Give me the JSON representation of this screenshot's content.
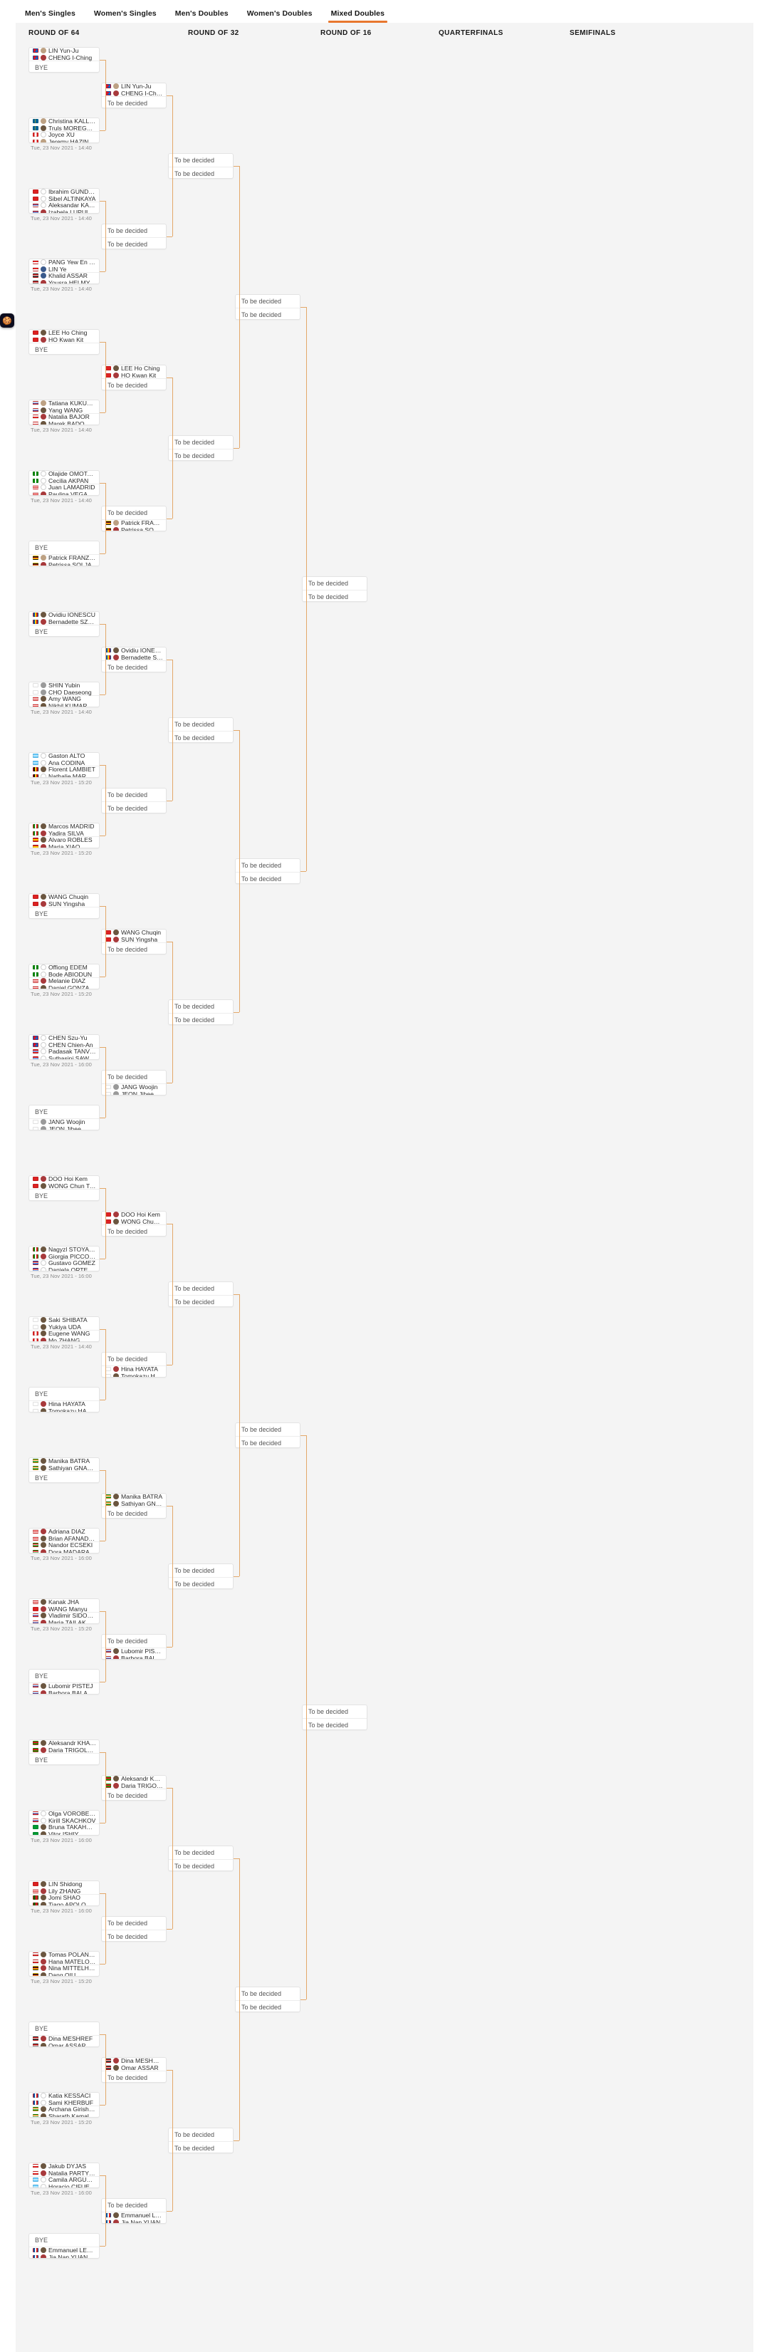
{
  "tabs": [
    {
      "label": "Men's Singles",
      "active": false
    },
    {
      "label": "Women's Singles",
      "active": false
    },
    {
      "label": "Men's Doubles",
      "active": false
    },
    {
      "label": "Women's Doubles",
      "active": false
    },
    {
      "label": "Mixed Doubles",
      "active": true
    }
  ],
  "rounds": [
    {
      "label": "ROUND OF 64"
    },
    {
      "label": "ROUND OF 32"
    },
    {
      "label": "ROUND OF 16"
    },
    {
      "label": "QUARTERFINALS"
    },
    {
      "label": "SEMIFINALS"
    }
  ],
  "cookie": {
    "icon": "cookie-icon",
    "glyph": "🍪"
  },
  "labels": {
    "bye": "BYE",
    "tbd": "To be decided"
  },
  "r64": [
    {
      "date": "",
      "a": [
        {
          "n": "LIN Yun-Ju",
          "f": "tpe",
          "av": "f-tan"
        },
        {
          "n": "CHENG I-Ching",
          "f": "tpe",
          "av": "f-red"
        }
      ],
      "b": "BYE"
    },
    {
      "date": "Tue, 23 Nov 2021 - 14:40",
      "a": [
        {
          "n": "Christina KALLBERG",
          "f": "swe",
          "av": "f-tan"
        },
        {
          "n": "Truls MOREGARD",
          "f": "swe",
          "av": "f-dark"
        }
      ],
      "b": [
        {
          "n": "Joyce XU",
          "f": "can",
          "av": "f-empty"
        },
        {
          "n": "Jeremy HAZIN",
          "f": "can",
          "av": "f-tan"
        }
      ]
    },
    {
      "date": "Tue, 23 Nov 2021 - 14:40",
      "a": [
        {
          "n": "Ibrahim GUNDUZ",
          "f": "tur",
          "av": "f-empty"
        },
        {
          "n": "Sibel ALTINKAYA",
          "f": "tur",
          "av": "f-empty"
        }
      ],
      "b": [
        {
          "n": "Aleksandar KARAKASEVIC",
          "f": "srb",
          "av": "f-empty"
        },
        {
          "n": "Izabela LUPULESKU",
          "f": "srb",
          "av": "f-red"
        }
      ]
    },
    {
      "date": "Tue, 23 Nov 2021 - 14:40",
      "a": [
        {
          "n": "PANG Yew En Koen",
          "f": "sgp",
          "av": "f-empty"
        },
        {
          "n": "LIN Ye",
          "f": "sgp",
          "av": "f-blue"
        }
      ],
      "b": [
        {
          "n": "Khalid ASSAR",
          "f": "egy",
          "av": "f-blue"
        },
        {
          "n": "Yousra HELMY",
          "f": "egy",
          "av": "f-red"
        }
      ]
    },
    {
      "date": "",
      "a": [
        {
          "n": "LEE Ho Ching",
          "f": "hkg",
          "av": "f-dark"
        },
        {
          "n": "HO Kwan Kit",
          "f": "hkg",
          "av": "f-red"
        }
      ],
      "b": "BYE"
    },
    {
      "date": "Tue, 23 Nov 2021 - 14:40",
      "a": [
        {
          "n": "Tatiana KUKULKOVA",
          "f": "svk",
          "av": "f-tan"
        },
        {
          "n": "Yang WANG",
          "f": "svk",
          "av": "f-dark"
        }
      ],
      "b": [
        {
          "n": "Natalia BAJOR",
          "f": "pol",
          "av": "f-red"
        },
        {
          "n": "Marek BADOWSKI",
          "f": "pol",
          "av": "f-dark"
        }
      ]
    },
    {
      "date": "Tue, 23 Nov 2021 - 14:40",
      "a": [
        {
          "n": "Olajide OMOTAYO",
          "f": "ngr",
          "av": "f-empty"
        },
        {
          "n": "Cecilia AKPAN",
          "f": "ngr",
          "av": "f-empty"
        }
      ],
      "b": [
        {
          "n": "Juan LAMADRID",
          "f": "pur",
          "av": "f-empty"
        },
        {
          "n": "Paulina VEGA",
          "f": "pur",
          "av": "f-red"
        }
      ]
    },
    {
      "date": "",
      "a": "BYE",
      "b": [
        {
          "n": "Patrick FRANZISKA",
          "f": "ger",
          "av": "f-tan"
        },
        {
          "n": "Petrissa SOLJA",
          "f": "ger",
          "av": "f-red"
        }
      ]
    },
    {
      "date": "",
      "a": [
        {
          "n": "Ovidiu IONESCU",
          "f": "rou",
          "av": "f-dark"
        },
        {
          "n": "Bernadette SZOCS",
          "f": "rou",
          "av": "f-red"
        }
      ],
      "b": "BYE"
    },
    {
      "date": "Tue, 23 Nov 2021 - 14:40",
      "a": [
        {
          "n": "SHIN Yubin",
          "f": "kor",
          "av": "f-grey"
        },
        {
          "n": "CHO Daeseong",
          "f": "kor",
          "av": "f-grey"
        }
      ],
      "b": [
        {
          "n": "Amy WANG",
          "f": "usa",
          "av": "f-dark"
        },
        {
          "n": "Nikhil KUMAR",
          "f": "usa",
          "av": "f-dark"
        }
      ]
    },
    {
      "date": "Tue, 23 Nov 2021 - 15:20",
      "a": [
        {
          "n": "Gaston ALTO",
          "f": "arg",
          "av": "f-empty"
        },
        {
          "n": "Ana CODINA",
          "f": "arg",
          "av": "f-empty"
        }
      ],
      "b": [
        {
          "n": "Florent LAMBIET",
          "f": "bel",
          "av": "f-dark"
        },
        {
          "n": "Nathalie MARCHETTI",
          "f": "bel",
          "av": "f-empty"
        }
      ]
    },
    {
      "date": "Tue, 23 Nov 2021 - 15:20",
      "a": [
        {
          "n": "Marcos MADRID",
          "f": "mex",
          "av": "f-dark"
        },
        {
          "n": "Yadira SILVA",
          "f": "mex",
          "av": "f-red"
        }
      ],
      "b": [
        {
          "n": "Alvaro ROBLES",
          "f": "esp",
          "av": "f-dark"
        },
        {
          "n": "Maria XIAO",
          "f": "esp",
          "av": "f-red"
        }
      ]
    },
    {
      "date": "",
      "a": [
        {
          "n": "WANG Chuqin",
          "f": "chn",
          "av": "f-dark"
        },
        {
          "n": "SUN Yingsha",
          "f": "chn",
          "av": "f-red"
        }
      ],
      "b": "BYE"
    },
    {
      "date": "Tue, 23 Nov 2021 - 15:20",
      "a": [
        {
          "n": "Offiong EDEM",
          "f": "ngr",
          "av": "f-empty"
        },
        {
          "n": "Bode ABIODUN",
          "f": "ngr",
          "av": "f-empty"
        }
      ],
      "b": [
        {
          "n": "Melanie DIAZ",
          "f": "pur",
          "av": "f-red"
        },
        {
          "n": "Daniel GONZALEZ",
          "f": "pur",
          "av": "f-dark"
        }
      ]
    },
    {
      "date": "Tue, 23 Nov 2021 - 16:00",
      "a": [
        {
          "n": "CHEN Szu-Yu",
          "f": "tpe",
          "av": "f-empty"
        },
        {
          "n": "CHEN Chien-An",
          "f": "tpe",
          "av": "f-empty"
        }
      ],
      "b": [
        {
          "n": "Padasak TANVIRIYAVECHAKUL",
          "f": "tha",
          "av": "f-empty"
        },
        {
          "n": "Suthasini SAWETTABUT",
          "f": "tha",
          "av": "f-empty"
        }
      ]
    },
    {
      "date": "",
      "a": "BYE",
      "b": [
        {
          "n": "JANG Woojin",
          "f": "kor",
          "av": "f-grey"
        },
        {
          "n": "JEON Jihee",
          "f": "kor",
          "av": "f-grey"
        }
      ]
    },
    {
      "date": "",
      "a": [
        {
          "n": "DOO Hoi Kem",
          "f": "hkg",
          "av": "f-red"
        },
        {
          "n": "WONG Chun Ting",
          "f": "hkg",
          "av": "f-dark"
        }
      ],
      "b": "BYE"
    },
    {
      "date": "Tue, 23 Nov 2021 - 16:00",
      "a": [
        {
          "n": "Nagyzl STOYANOV",
          "f": "ita",
          "av": "f-dark"
        },
        {
          "n": "Giorgia PICCOLIN",
          "f": "ita",
          "av": "f-red"
        }
      ],
      "b": [
        {
          "n": "Gustavo GOMEZ",
          "f": "par",
          "av": "f-empty"
        },
        {
          "n": "Daniela ORTEGA",
          "f": "par",
          "av": "f-empty"
        }
      ]
    },
    {
      "date": "Tue, 23 Nov 2021 - 14:40",
      "a": [
        {
          "n": "Saki SHIBATA",
          "f": "jpn",
          "av": "f-dark"
        },
        {
          "n": "Yukiya UDA",
          "f": "jpn",
          "av": "f-dark"
        }
      ],
      "b": [
        {
          "n": "Eugene WANG",
          "f": "can",
          "av": "f-dark"
        },
        {
          "n": "Mo ZHANG",
          "f": "can",
          "av": "f-red"
        }
      ]
    },
    {
      "date": "",
      "a": "BYE",
      "b": [
        {
          "n": "Hina HAYATA",
          "f": "jpn",
          "av": "f-red"
        },
        {
          "n": "Tomokazu HARIMOTO",
          "f": "jpn",
          "av": "f-dark"
        }
      ]
    },
    {
      "date": "",
      "a": [
        {
          "n": "Manika BATRA",
          "f": "ind",
          "av": "f-dark"
        },
        {
          "n": "Sathiyan GNANASEKARAN",
          "f": "ind",
          "av": "f-dark"
        }
      ],
      "b": "BYE"
    },
    {
      "date": "Tue, 23 Nov 2021 - 16:00",
      "a": [
        {
          "n": "Adriana DIAZ",
          "f": "pur",
          "av": "f-red"
        },
        {
          "n": "Brian AFANADOR",
          "f": "pur",
          "av": "f-dark"
        }
      ],
      "b": [
        {
          "n": "Nandor ECSEKI",
          "f": "hun",
          "av": "f-dark"
        },
        {
          "n": "Dora MADARASZ",
          "f": "hun",
          "av": "f-red"
        }
      ]
    },
    {
      "date": "Tue, 23 Nov 2021 - 15:20",
      "a": [
        {
          "n": "Kanak JHA",
          "f": "usa",
          "av": "f-dark"
        },
        {
          "n": "WANG Manyu",
          "f": "chn",
          "av": "f-red"
        }
      ],
      "b": [
        {
          "n": "Vladimir SIDORENKO",
          "f": "rus",
          "av": "f-dark"
        },
        {
          "n": "Maria TAILAKOVA",
          "f": "rus",
          "av": "f-red"
        }
      ]
    },
    {
      "date": "",
      "a": "BYE",
      "b": [
        {
          "n": "Lubomir PISTEJ",
          "f": "svk",
          "av": "f-dark"
        },
        {
          "n": "Barbora BALAZOVA",
          "f": "svk",
          "av": "f-red"
        }
      ]
    },
    {
      "date": "",
      "a": [
        {
          "n": "Aleksandr KHANIN",
          "f": "blr",
          "av": "f-dark"
        },
        {
          "n": "Daria TRIGOLOS",
          "f": "blr",
          "av": "f-red"
        }
      ],
      "b": "BYE"
    },
    {
      "date": "Tue, 23 Nov 2021 - 16:00",
      "a": [
        {
          "n": "Olga VOROBEVA",
          "f": "rus",
          "av": "f-empty"
        },
        {
          "n": "Kirill SKACHKOV",
          "f": "rus",
          "av": "f-empty"
        }
      ],
      "b": [
        {
          "n": "Bruna TAKAHASHI",
          "f": "bra",
          "av": "f-dark"
        },
        {
          "n": "Vitor ISHIY",
          "f": "bra",
          "av": "f-dark"
        }
      ]
    },
    {
      "date": "Tue, 23 Nov 2021 - 16:00",
      "a": [
        {
          "n": "LIN Shidong",
          "f": "chn",
          "av": "f-dark"
        },
        {
          "n": "Lily ZHANG",
          "f": "usa",
          "av": "f-red"
        }
      ],
      "b": [
        {
          "n": "Jomi SHAO",
          "f": "por",
          "av": "f-dark"
        },
        {
          "n": "Tiago APOLONIA",
          "f": "por",
          "av": "f-dark"
        }
      ]
    },
    {
      "date": "Tue, 23 Nov 2021 - 15:20",
      "a": [
        {
          "n": "Tomas POLANSKY",
          "f": "cze",
          "av": "f-dark"
        },
        {
          "n": "Hana MATELOVA",
          "f": "cze",
          "av": "f-red"
        }
      ],
      "b": [
        {
          "n": "Nina MITTELHAM",
          "f": "ger",
          "av": "f-red"
        },
        {
          "n": "Dang QIU",
          "f": "ger",
          "av": "f-dark"
        }
      ]
    },
    {
      "date": "",
      "a": "BYE",
      "b": [
        {
          "n": "Dina MESHREF",
          "f": "egy",
          "av": "f-red"
        },
        {
          "n": "Omar ASSAR",
          "f": "egy",
          "av": "f-dark"
        }
      ]
    },
    {
      "date": "Tue, 23 Nov 2021 - 15:20",
      "a": [
        {
          "n": "Katia KESSACI",
          "f": "fra",
          "av": "f-empty"
        },
        {
          "n": "Sami KHERBUF",
          "f": "fra",
          "av": "f-empty"
        }
      ],
      "b": [
        {
          "n": "Archana Girish KAMATH",
          "f": "ind",
          "av": "f-dark"
        },
        {
          "n": "Sharath Kamal ACHANTA",
          "f": "ind",
          "av": "f-dark"
        }
      ]
    },
    {
      "date": "Tue, 23 Nov 2021 - 16:00",
      "a": [
        {
          "n": "Jakub DYJAS",
          "f": "pol",
          "av": "f-dark"
        },
        {
          "n": "Natalia PARTYKA",
          "f": "pol",
          "av": "f-red"
        }
      ],
      "b": [
        {
          "n": "Camila ARGUELLES",
          "f": "arg",
          "av": "f-empty"
        },
        {
          "n": "Horacio CIFUENTES",
          "f": "arg",
          "av": "f-empty"
        }
      ]
    },
    {
      "date": "",
      "a": "BYE",
      "b": [
        {
          "n": "Emmanuel LEBESSON",
          "f": "fra",
          "av": "f-dark"
        },
        {
          "n": "Jia Nan YUAN",
          "f": "fra",
          "av": "f-red"
        }
      ]
    }
  ],
  "r32": [
    {
      "a": [
        {
          "n": "LIN Yun-Ju",
          "f": "tpe",
          "av": "f-tan"
        },
        {
          "n": "CHENG I-Ching",
          "f": "tpe",
          "av": "f-red"
        }
      ],
      "b": "TBD"
    },
    {
      "a": "TBD",
      "b": "TBD"
    },
    {
      "a": [
        {
          "n": "LEE Ho Ching",
          "f": "hkg",
          "av": "f-dark"
        },
        {
          "n": "HO Kwan Kit",
          "f": "hkg",
          "av": "f-red"
        }
      ],
      "b": "TBD"
    },
    {
      "a": "TBD",
      "b": [
        {
          "n": "Patrick FRANZISKA",
          "f": "ger",
          "av": "f-tan"
        },
        {
          "n": "Petrissa SOLJA",
          "f": "ger",
          "av": "f-red"
        }
      ]
    },
    {
      "a": [
        {
          "n": "Ovidiu IONESCU",
          "f": "rou",
          "av": "f-dark"
        },
        {
          "n": "Bernadette SZOCS",
          "f": "rou",
          "av": "f-red"
        }
      ],
      "b": "TBD"
    },
    {
      "a": "TBD",
      "b": "TBD"
    },
    {
      "a": [
        {
          "n": "WANG Chuqin",
          "f": "chn",
          "av": "f-dark"
        },
        {
          "n": "SUN Yingsha",
          "f": "chn",
          "av": "f-red"
        }
      ],
      "b": "TBD"
    },
    {
      "a": "TBD",
      "b": [
        {
          "n": "JANG Woojin",
          "f": "kor",
          "av": "f-grey"
        },
        {
          "n": "JEON Jihee",
          "f": "kor",
          "av": "f-grey"
        }
      ]
    },
    {
      "a": [
        {
          "n": "DOO Hoi Kem",
          "f": "hkg",
          "av": "f-red"
        },
        {
          "n": "WONG Chun Ting",
          "f": "hkg",
          "av": "f-dark"
        }
      ],
      "b": "TBD"
    },
    {
      "a": "TBD",
      "b": [
        {
          "n": "Hina HAYATA",
          "f": "jpn",
          "av": "f-red"
        },
        {
          "n": "Tomokazu HARIMOTO",
          "f": "jpn",
          "av": "f-dark"
        }
      ]
    },
    {
      "a": [
        {
          "n": "Manika BATRA",
          "f": "ind",
          "av": "f-dark"
        },
        {
          "n": "Sathiyan GNANASEKARAN",
          "f": "ind",
          "av": "f-dark"
        }
      ],
      "b": "TBD"
    },
    {
      "a": "TBD",
      "b": [
        {
          "n": "Lubomir PISTEJ",
          "f": "svk",
          "av": "f-dark"
        },
        {
          "n": "Barbora BALAZOVA",
          "f": "svk",
          "av": "f-red"
        }
      ]
    },
    {
      "a": [
        {
          "n": "Aleksandr KHANIN",
          "f": "blr",
          "av": "f-dark"
        },
        {
          "n": "Daria TRIGOLOS",
          "f": "blr",
          "av": "f-red"
        }
      ],
      "b": "TBD"
    },
    {
      "a": "TBD",
      "b": "TBD"
    },
    {
      "a": [
        {
          "n": "Dina MESHREF",
          "f": "egy",
          "av": "f-red"
        },
        {
          "n": "Omar ASSAR",
          "f": "egy",
          "av": "f-dark"
        }
      ],
      "b": "TBD"
    },
    {
      "a": "TBD",
      "b": [
        {
          "n": "Emmanuel LEBESSON",
          "f": "fra",
          "av": "f-dark"
        },
        {
          "n": "Jia Nan YUAN",
          "f": "fra",
          "av": "f-red"
        }
      ]
    }
  ],
  "r16_count": 8,
  "qf_count": 4,
  "sf_count": 2
}
